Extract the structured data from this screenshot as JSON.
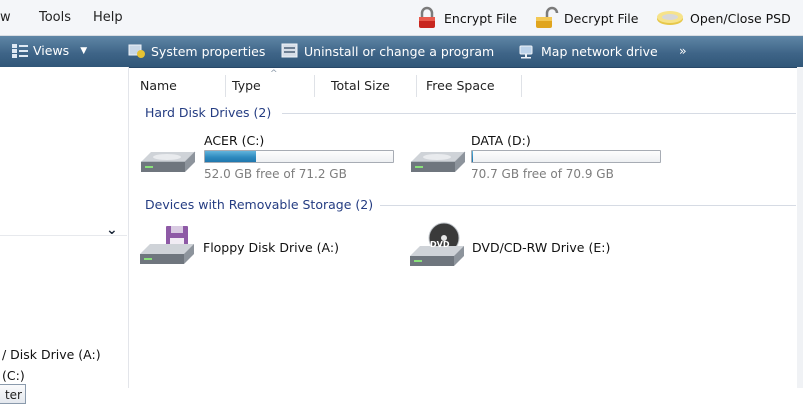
{
  "menu": {
    "partial_view": "w",
    "tools": "Tools",
    "help": "Help",
    "encrypt": "Encrypt File",
    "decrypt": "Decrypt File",
    "open_close": "Open/Close PSD"
  },
  "command_bar": {
    "views": "Views",
    "system_properties": "System properties",
    "uninstall": "Uninstall or change a program",
    "map_drive": "Map network drive",
    "more": "»"
  },
  "columns": {
    "name": "Name",
    "type": "Type",
    "total_size": "Total Size",
    "free_space": "Free Space"
  },
  "groups": {
    "hard_disks": "Hard Disk Drives (2)",
    "removable": "Devices with Removable Storage (2)"
  },
  "drives": {
    "c": {
      "label": "ACER (C:)",
      "free_text": "52.0 GB free of 71.2 GB",
      "used_fraction": 0.27
    },
    "d": {
      "label": "DATA (D:)",
      "free_text": "70.7 GB free of 70.9 GB",
      "used_fraction": 0.003
    },
    "floppy": {
      "label": "Floppy Disk Drive (A:)"
    },
    "dvd": {
      "label": "DVD/CD-RW Drive (E:)",
      "badge": "DVD"
    }
  },
  "left_pane": {
    "button_partial": "ter",
    "item1": "/ Disk Drive (A:)",
    "item2": "(C:)"
  }
}
